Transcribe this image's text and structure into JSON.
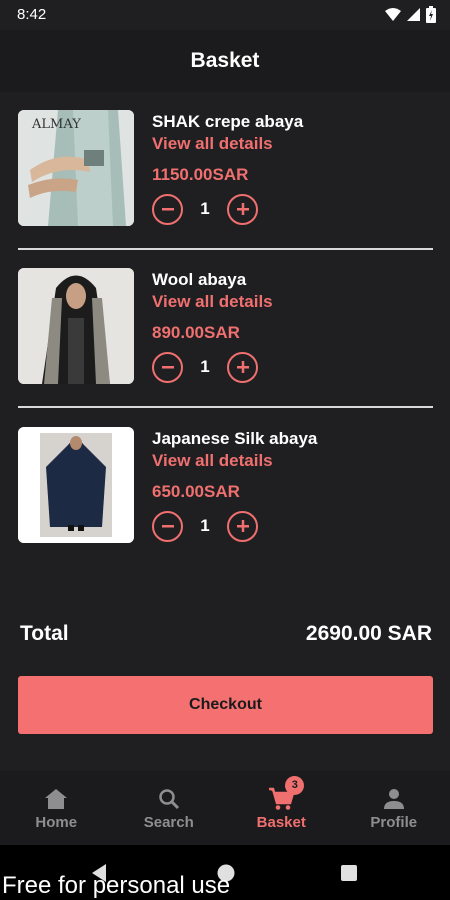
{
  "status_bar": {
    "time": "8:42"
  },
  "header": {
    "title": "Basket"
  },
  "items": [
    {
      "name": "SHAK crepe abaya",
      "details_link": "View all details",
      "price": "1150.00SAR",
      "quantity": "1"
    },
    {
      "name": "Wool abaya",
      "details_link": "View all details",
      "price": "890.00SAR",
      "quantity": "1"
    },
    {
      "name": "Japanese Silk abaya",
      "details_link": "View all details",
      "price": "650.00SAR",
      "quantity": "1"
    }
  ],
  "summary": {
    "total_label": "Total",
    "total_value": "2690.00 SAR"
  },
  "checkout_label": "Checkout",
  "nav": {
    "items": [
      {
        "label": "Home",
        "icon": "home-icon"
      },
      {
        "label": "Search",
        "icon": "search-icon"
      },
      {
        "label": "Basket",
        "icon": "cart-icon",
        "badge": "3",
        "active": true
      },
      {
        "label": "Profile",
        "icon": "person-icon"
      }
    ]
  },
  "image_labels": {
    "brand_logo": "ALMAY"
  },
  "watermark": "Free for personal use",
  "colors": {
    "accent": "#f06f6f",
    "background": "#1f1f21",
    "checkout": "#f57070"
  }
}
